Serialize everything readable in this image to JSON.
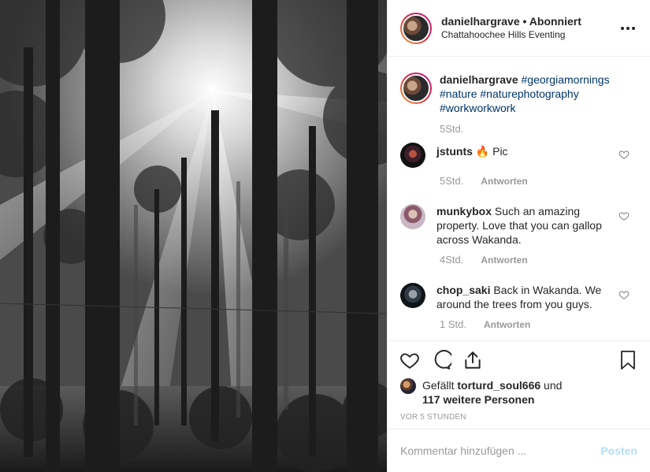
{
  "header": {
    "username": "danielhargrave",
    "separator": " • ",
    "follow_status": "Abonniert",
    "location": "Chattahoochee Hills Eventing",
    "more_icon": "more-options-icon"
  },
  "caption": {
    "username": "danielhargrave",
    "hashtags": [
      "#georgiamornings",
      "#nature",
      "#naturephotography",
      "#workworkwork"
    ],
    "time": "5Std."
  },
  "comments": [
    {
      "username": "jstunts",
      "text": "🔥 Pic",
      "time": "5Std.",
      "reply_label": "Antworten"
    },
    {
      "username": "munkybox",
      "text": "Such an amazing property. Love that you can gallop across Wakanda.",
      "time": "4Std.",
      "reply_label": "Antworten"
    },
    {
      "username": "chop_saki",
      "text": "Back in Wakanda. We around the trees from you guys.",
      "time": "1 Std.",
      "reply_label": "Antworten"
    }
  ],
  "likes": {
    "prefix": "Gefällt ",
    "user": "torturd_soul666",
    "middle": " und",
    "others": "117 weitere Personen"
  },
  "timestamp": "VOR 5 STUNDEN",
  "add_comment": {
    "placeholder": "Kommentar hinzufügen ...",
    "post_label": "Posten"
  },
  "colors": {
    "hashtag": "#003569",
    "post_button": "#b2dffc",
    "muted": "#999999"
  }
}
